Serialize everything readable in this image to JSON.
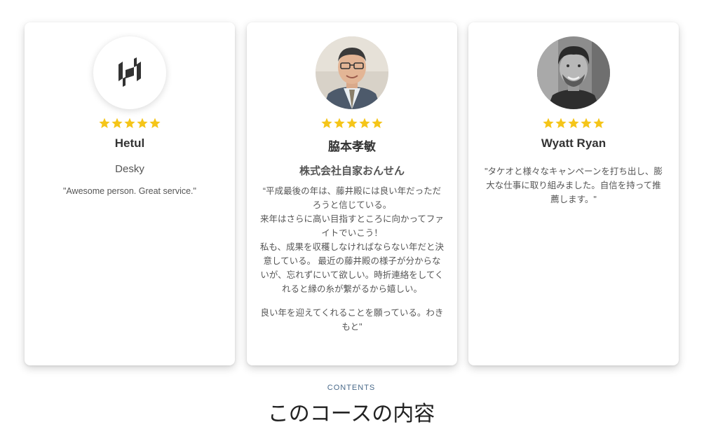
{
  "testimonials": [
    {
      "avatar_icon": "desky-logo-icon",
      "rating": 5,
      "name": "Hetul",
      "company": "Desky",
      "quote": [
        "\"Awesome person. Great service.\""
      ]
    },
    {
      "avatar_icon": "person-photo",
      "rating": 5,
      "name": "脇本孝敏",
      "company": "株式会社自家おんせん",
      "quote": [
        "“平成最後の年は、藤井殿には良い年だっただろうと信じている。",
        "来年はさらに高い目指すところに向かってファイトでいこう！",
        "私も、成果を収穫しなければならない年だと決意している。 最近の藤井殿の様子が分からないが、忘れずにいて欲しい。時折連絡をしてくれると縁の糸が繋がるから嬉しい。",
        "良い年を迎えてくれることを願っている。わきもと\""
      ]
    },
    {
      "avatar_icon": "person-photo",
      "rating": 5,
      "name": "Wyatt Ryan",
      "company": "",
      "quote": [
        "\"タケオと様々なキャンペーンを打ち出し、膨大な仕事に取り組みました。自信を持って推薦します。\""
      ]
    }
  ],
  "section": {
    "label": "CONTENTS",
    "title": "このコースの内容"
  },
  "colors": {
    "star": "#f5c518",
    "card_bg": "#ffffff",
    "section_label": "#4a6a8a"
  }
}
